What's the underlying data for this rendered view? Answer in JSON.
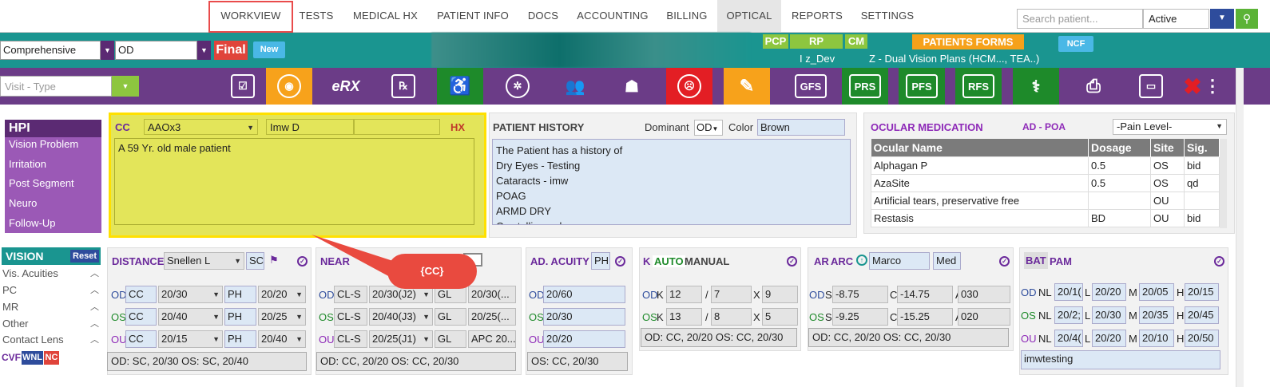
{
  "topnav": {
    "tabs": [
      "WORKVIEW",
      "TESTS",
      "MEDICAL HX",
      "PATIENT INFO",
      "DOCS",
      "ACCOUNTING",
      "BILLING",
      "OPTICAL",
      "REPORTS",
      "SETTINGS"
    ],
    "search_placeholder": "Search patient...",
    "status_value": "Active"
  },
  "exam": {
    "type": "Comprehensive",
    "eye": "OD",
    "final_label": "Final",
    "new_label": "New"
  },
  "tags": {
    "pcp": "PCP",
    "rp": "RP",
    "cm": "CM",
    "patients_forms": "PATIENTS FORMS",
    "ncf": "NCF",
    "provider": "I z_Dev",
    "plan": "Z - Dual Vision Plans (HCM..., TEA..)"
  },
  "toolbar": {
    "visit_type_placeholder": "Visit - Type",
    "erx": "eRX",
    "gfs": "GFS",
    "prs": "PRS",
    "pfs": "PFS",
    "rfs": "RFS"
  },
  "hpi": {
    "title": "HPI",
    "items": [
      "Vision Problem",
      "Irritation",
      "Post Segment",
      "Neuro",
      "Follow-Up"
    ]
  },
  "cc": {
    "label": "CC",
    "value_a": "AAOx3",
    "value_b": "Imw D",
    "hx_label": "HX",
    "text": "A 59 Yr. old male patient",
    "callout": "{CC}"
  },
  "patient_history": {
    "title": "PATIENT HISTORY",
    "dominant_label": "Dominant",
    "dominant_value": "OD",
    "color_label": "Color",
    "color_value": "Brown",
    "lines": [
      "The Patient has a history of",
      "Dry Eyes - Testing",
      "Cataracts - imw",
      "POAG",
      "ARMD DRY",
      "Crystalline ...d..."
    ]
  },
  "ocular_medication": {
    "title": "OCULAR MEDICATION",
    "poa": "AD - POA",
    "pain_level": "-Pain Level-",
    "headers": [
      "Ocular Name",
      "Dosage",
      "Site",
      "Sig."
    ],
    "rows": [
      [
        "Alphagan P",
        "0.5",
        "OS",
        "bid"
      ],
      [
        "AzaSite",
        "0.5",
        "OS",
        "qd"
      ],
      [
        "Artificial tears, preservative free",
        "",
        "OU",
        ""
      ],
      [
        "Restasis",
        "BD",
        "OU",
        "bid"
      ]
    ]
  },
  "vision": {
    "title": "VISION",
    "reset": "Reset",
    "items": [
      "Vis. Acuities",
      "PC",
      "MR",
      "Other",
      "Contact Lens"
    ],
    "cvf": "CVF",
    "wnl": "WNL",
    "nc": "NC"
  },
  "distance": {
    "title": "DISTANCE",
    "chart": "Snellen L",
    "sc": "SC",
    "rows": [
      {
        "eye": "OD",
        "c": "CC",
        "v": "20/30",
        "ph": "PH",
        "pv": "20/20"
      },
      {
        "eye": "OS",
        "c": "CC",
        "v": "20/40",
        "ph": "PH",
        "pv": "20/25"
      },
      {
        "eye": "OU",
        "c": "CC",
        "v": "20/15",
        "ph": "PH",
        "pv": "20/40"
      }
    ],
    "note": "OD: SC, 20/30 OS: SC, 20/40"
  },
  "near": {
    "title": "NEAR",
    "rows": [
      {
        "eye": "OD",
        "c": "CL-S",
        "v": "20/30(J2)",
        "g": "GL",
        "pv": "20/30(..."
      },
      {
        "eye": "OS",
        "c": "CL-S",
        "v": "20/40(J3)",
        "g": "GL",
        "pv": "20/25(..."
      },
      {
        "eye": "OU",
        "c": "CL-S",
        "v": "20/25(J1)",
        "g": "GL",
        "pv": "APC 20..."
      }
    ],
    "note": "OD: CC, 20/20 OS: CC, 20/30"
  },
  "ad_acuity": {
    "title": "AD. ACUITY",
    "ph": "PH",
    "rows": [
      {
        "eye": "OD",
        "v": "20/60"
      },
      {
        "eye": "OS",
        "v": "20/30"
      },
      {
        "eye": "OU",
        "v": "20/20"
      }
    ],
    "note": "OS: CC, 20/30"
  },
  "k": {
    "title": "K",
    "auto": "AUTO",
    "manual": "MANUAL",
    "rows": [
      {
        "eye": "OD",
        "k": "K",
        "a": "12",
        "b": "7",
        "x": "X",
        "c": "9"
      },
      {
        "eye": "OS",
        "k": "K",
        "a": "13",
        "b": "8",
        "x": "X",
        "c": "5"
      }
    ],
    "note": "OD: CC, 20/20 OS: CC, 20/30"
  },
  "ar": {
    "title": "AR",
    "arc": "ARC",
    "name": "Marco",
    "med": "Med",
    "rows": [
      {
        "eye": "OD",
        "s": "-8.75",
        "c": "-14.75",
        "a": "030"
      },
      {
        "eye": "OS",
        "s": "-9.25",
        "c": "-15.25",
        "a": "020"
      }
    ],
    "note": "OD: CC, 20/20 OS: CC, 20/30"
  },
  "bat": {
    "title": "BAT",
    "pam": "PAM",
    "rows": [
      {
        "eye": "OD",
        "nl": "20/1(",
        "l": "20/20",
        "m": "20/05",
        "h": "20/15"
      },
      {
        "eye": "OS",
        "nl": "20/2;",
        "l": "20/30",
        "m": "20/35",
        "h": "20/45"
      },
      {
        "eye": "OU",
        "nl": "20/4(",
        "l": "20/20",
        "m": "20/10",
        "h": "20/50"
      }
    ],
    "note": "imwtesting"
  }
}
